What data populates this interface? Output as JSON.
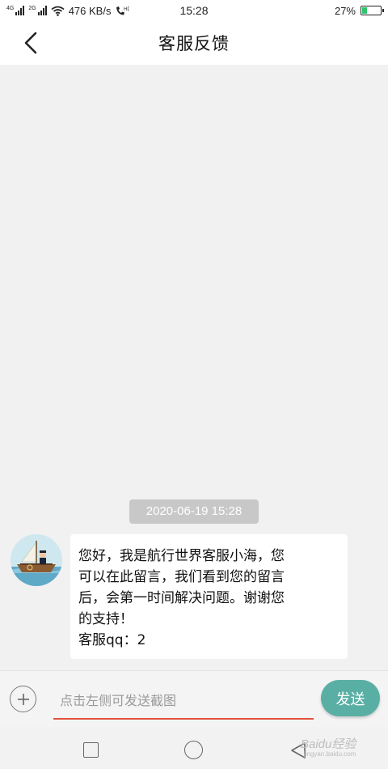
{
  "status_bar": {
    "speed": "476 KB/s",
    "time": "15:28",
    "battery_percent": "27%",
    "battery_level": 0.27,
    "network1": "4G",
    "network2": "2G",
    "icons": [
      "signal-icon",
      "wifi-icon",
      "hd-call-icon",
      "battery-icon"
    ]
  },
  "header": {
    "title": "客服反馈",
    "back_icon": "chevron-left-icon"
  },
  "chat": {
    "timestamp": "2020-06-19 15:28",
    "message": {
      "lines": [
        "您好，我是航行世界客服小海，您",
        "可以在此留言，我们看到您的留言",
        "后，会第一时间解决问题。谢谢您",
        "的支持！",
        "客服qq：2"
      ]
    }
  },
  "input_bar": {
    "placeholder": "点击左侧可发送截图",
    "value": "",
    "send_label": "发送",
    "accent_color": "#5aafa4",
    "underline_color": "#e0503a"
  },
  "nav_bar": {
    "watermark": "Baidu经验",
    "watermark_sub": "jingyan.baidu.com"
  }
}
